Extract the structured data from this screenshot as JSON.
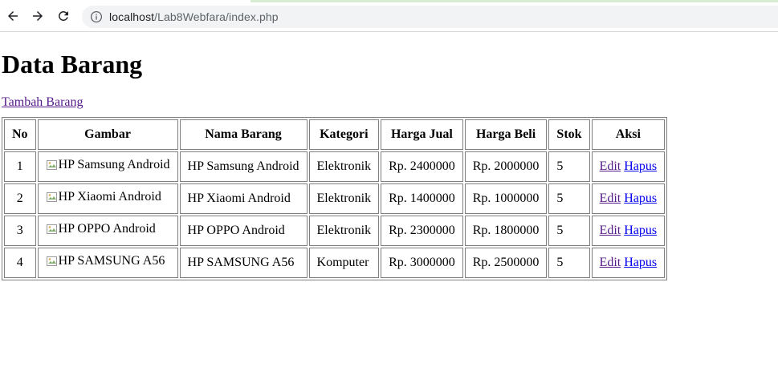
{
  "browser": {
    "url_host": "localhost",
    "url_path": "/Lab8Webfara/index.php"
  },
  "page": {
    "title": "Data Barang",
    "add_link": "Tambah Barang"
  },
  "table": {
    "headers": [
      "No",
      "Gambar",
      "Nama Barang",
      "Kategori",
      "Harga Jual",
      "Harga Beli",
      "Stok",
      "Aksi"
    ],
    "rows": [
      {
        "no": "1",
        "gambar_alt": "HP Samsung Android",
        "nama": "HP Samsung Android",
        "kategori": "Elektronik",
        "harga_jual": "Rp. 2400000",
        "harga_beli": "Rp. 2000000",
        "stok": "5",
        "edit": "Edit",
        "hapus": "Hapus"
      },
      {
        "no": "2",
        "gambar_alt": "HP Xiaomi Android",
        "nama": "HP Xiaomi Android",
        "kategori": "Elektronik",
        "harga_jual": "Rp. 1400000",
        "harga_beli": "Rp. 1000000",
        "stok": "5",
        "edit": "Edit",
        "hapus": "Hapus"
      },
      {
        "no": "3",
        "gambar_alt": "HP OPPO Android",
        "nama": "HP OPPO Android",
        "kategori": "Elektronik",
        "harga_jual": "Rp. 2300000",
        "harga_beli": "Rp. 1800000",
        "stok": "5",
        "edit": "Edit",
        "hapus": "Hapus"
      },
      {
        "no": "4",
        "gambar_alt": "HP SAMSUNG A56",
        "nama": "HP SAMSUNG A56",
        "kategori": "Komputer",
        "harga_jual": "Rp. 3000000",
        "harga_beli": "Rp. 2500000",
        "stok": "5",
        "edit": "Edit",
        "hapus": "Hapus"
      }
    ]
  },
  "icons": {
    "back": "back-arrow-icon",
    "forward": "forward-arrow-icon",
    "reload": "reload-icon",
    "info": "info-icon",
    "broken_image": "broken-image-icon"
  },
  "colors": {
    "visited_link": "#551a8b",
    "link": "#0000ee"
  }
}
